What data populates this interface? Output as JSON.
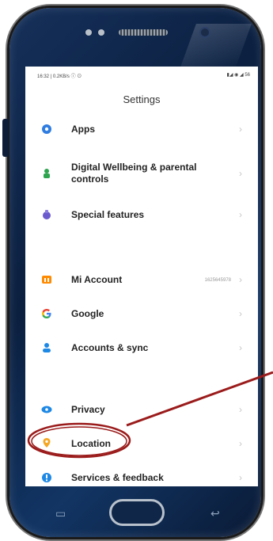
{
  "status_bar": {
    "left": "16:32 | 0.2KB/s ⓘ ⊙",
    "right": "▮◢ ◉ ◢ 56"
  },
  "header": {
    "title": "Settings"
  },
  "settings": {
    "items": [
      {
        "label": "Apps",
        "icon": "apps-gear-icon",
        "color": "#2f7de1"
      },
      {
        "label": "Digital Wellbeing & parental controls",
        "icon": "digital-wellbeing-icon",
        "color": "#2ea44f"
      },
      {
        "label": "Special features",
        "icon": "special-features-icon",
        "color": "#6a5acd"
      },
      {
        "label": "Mi Account",
        "icon": "mi-account-icon",
        "color": "#ff8a00",
        "value": "1625645978"
      },
      {
        "label": "Google",
        "icon": "google-icon",
        "color": "#4285f4"
      },
      {
        "label": "Accounts & sync",
        "icon": "accounts-person-icon",
        "color": "#1e88e5"
      },
      {
        "label": "Privacy",
        "icon": "privacy-eye-icon",
        "color": "#1e88e5"
      },
      {
        "label": "Location",
        "icon": "location-pin-icon",
        "color": "#f5a623"
      },
      {
        "label": "Services & feedback",
        "icon": "services-feedback-icon",
        "color": "#1e88e5"
      }
    ]
  },
  "annotation": {
    "color": "#9b1b1b"
  }
}
